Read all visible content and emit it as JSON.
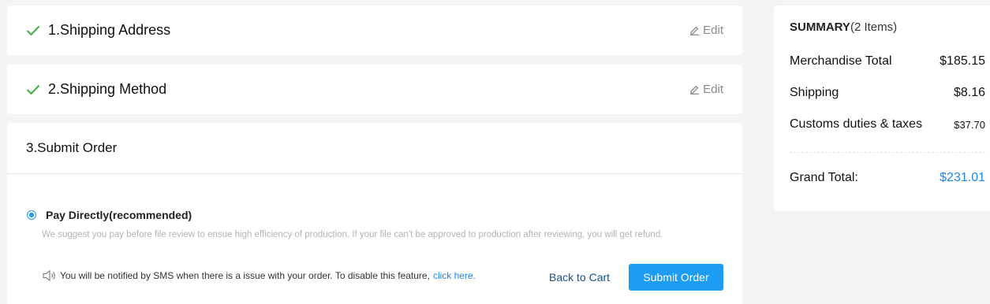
{
  "steps": {
    "address": {
      "title": "1.Shipping Address",
      "edit_label": "Edit"
    },
    "method": {
      "title": "2.Shipping Method",
      "edit_label": "Edit"
    },
    "submit": {
      "title": "3.Submit Order"
    }
  },
  "payment": {
    "option_label": "Pay Directly(recommended)",
    "selected": true,
    "note": "We suggest you pay before file review to ensue high efficiency of production. If your file can't be approved to production after reviewing, you will get refund."
  },
  "sms": {
    "text": "You will be notified by SMS when there is a issue with your order. To disable this feature,",
    "link_label": "click here."
  },
  "actions": {
    "back_label": "Back to Cart",
    "submit_label": "Submit Order"
  },
  "summary": {
    "title": "SUMMARY",
    "items_count": "(2 Items)",
    "rows": [
      {
        "label": "Merchandise Total",
        "value": "$185.15"
      },
      {
        "label": "Shipping",
        "value": "$8.16"
      },
      {
        "label": "Customs duties & taxes",
        "value": "$37.70"
      }
    ],
    "grand_label": "Grand Total:",
    "grand_value": "$231.01"
  },
  "colors": {
    "accent": "#1e9bf0",
    "check": "#3cb043",
    "page_bg": "#f4f4f4"
  },
  "icons": [
    "check-icon",
    "pencil-icon",
    "radio-icon",
    "speaker-icon"
  ]
}
